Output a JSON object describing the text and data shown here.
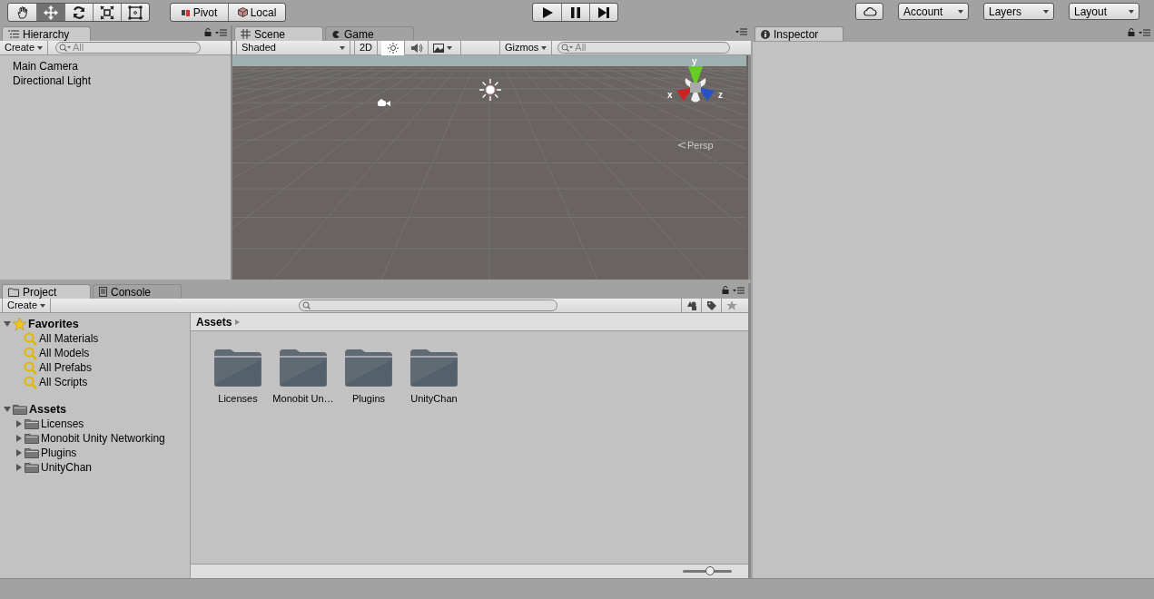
{
  "toolbar": {
    "tools": [
      {
        "kind": "hand",
        "selected": false
      },
      {
        "kind": "move",
        "selected": true
      },
      {
        "kind": "rotate",
        "selected": false
      },
      {
        "kind": "scale",
        "selected": false
      },
      {
        "kind": "rect",
        "selected": false
      }
    ],
    "pivot_buttons": [
      {
        "kind": "pivot",
        "label": "Pivot"
      },
      {
        "kind": "local",
        "label": "Local"
      }
    ],
    "play_controls": [
      {
        "kind": "play"
      },
      {
        "kind": "pause"
      },
      {
        "kind": "step"
      }
    ],
    "right_buttons": [
      {
        "kind": "cloud"
      },
      {
        "kind": "dropdown",
        "label": "Account"
      },
      {
        "kind": "dropdown",
        "label": "Layers"
      },
      {
        "kind": "dropdown",
        "label": "Layout"
      }
    ]
  },
  "hierarchy": {
    "tab": "Hierarchy",
    "create": "Create",
    "search_placeholder": "All",
    "items": [
      "Main Camera",
      "Directional Light"
    ]
  },
  "scene": {
    "tabs": [
      {
        "kind": "scene",
        "label": "Scene",
        "selected": true
      },
      {
        "kind": "game",
        "label": "Game",
        "selected": false
      }
    ],
    "shading": "Shaded",
    "mode_2d": "2D",
    "mode_2d_on": false,
    "lighting_on": true,
    "audio_on": false,
    "gizmos": "Gizmos",
    "search_placeholder": "All",
    "axes": {
      "x": "x",
      "y": "y",
      "z": "z"
    },
    "projection": "Persp"
  },
  "project": {
    "tabs": [
      {
        "kind": "project",
        "label": "Project",
        "selected": true
      },
      {
        "kind": "console",
        "label": "Console",
        "selected": false
      }
    ],
    "create": "Create",
    "favorites": {
      "label": "Favorites",
      "expanded": true,
      "items": [
        "All Materials",
        "All Models",
        "All Prefabs",
        "All Scripts"
      ]
    },
    "assets": {
      "label": "Assets",
      "expanded": true,
      "children": [
        {
          "label": "Licenses",
          "expanded": false
        },
        {
          "label": "Monobit Unity Networking",
          "expanded": false
        },
        {
          "label": "Plugins",
          "expanded": false
        },
        {
          "label": "UnityChan",
          "expanded": false
        }
      ]
    },
    "breadcrumb": "Assets",
    "folders": [
      "Licenses",
      "Monobit Un…",
      "Plugins",
      "UnityChan"
    ],
    "zoom_slider": {
      "level": 0.55
    }
  },
  "inspector": {
    "tab": "Inspector"
  }
}
